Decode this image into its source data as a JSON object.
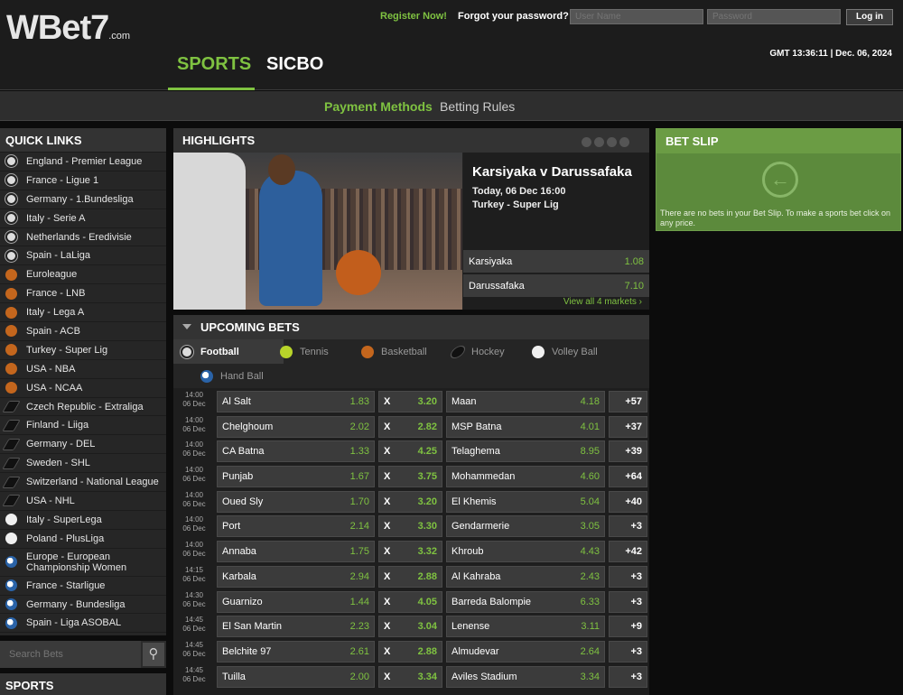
{
  "header": {
    "logo": "WBet7",
    "logo_suffix": ".com",
    "register": "Register Now!",
    "forgot": "Forgot your password?",
    "username_placeholder": "User Name",
    "password_placeholder": "Password",
    "login": "Log in",
    "clock": "GMT 13:36:11 | Dec. 06, 2024",
    "nav": {
      "sports": "SPORTS",
      "sicbo": "SICBO"
    }
  },
  "subnav": {
    "payment": "Payment Methods",
    "rules": "Betting Rules"
  },
  "quick_links": {
    "title": "QUICK LINKS",
    "items": [
      {
        "label": "England - Premier League",
        "icon": "football-icon"
      },
      {
        "label": "France - Ligue 1",
        "icon": "football-icon"
      },
      {
        "label": "Germany - 1.Bundesliga",
        "icon": "football-icon"
      },
      {
        "label": "Italy - Serie A",
        "icon": "football-icon"
      },
      {
        "label": "Netherlands - Eredivisie",
        "icon": "football-icon"
      },
      {
        "label": "Spain - LaLiga",
        "icon": "football-icon"
      },
      {
        "label": "Euroleague",
        "icon": "basketball-icon"
      },
      {
        "label": "France - LNB",
        "icon": "basketball-icon"
      },
      {
        "label": "Italy - Lega A",
        "icon": "basketball-icon"
      },
      {
        "label": "Spain - ACB",
        "icon": "basketball-icon"
      },
      {
        "label": "Turkey - Super Lig",
        "icon": "basketball-icon"
      },
      {
        "label": "USA - NBA",
        "icon": "basketball-icon"
      },
      {
        "label": "USA - NCAA",
        "icon": "basketball-icon"
      },
      {
        "label": "Czech Republic - Extraliga",
        "icon": "hockey-icon"
      },
      {
        "label": "Finland - Liiga",
        "icon": "hockey-icon"
      },
      {
        "label": "Germany - DEL",
        "icon": "hockey-icon"
      },
      {
        "label": "Sweden - SHL",
        "icon": "hockey-icon"
      },
      {
        "label": "Switzerland - National League",
        "icon": "hockey-icon"
      },
      {
        "label": "USA - NHL",
        "icon": "hockey-icon"
      },
      {
        "label": "Italy - SuperLega",
        "icon": "volleyball-icon"
      },
      {
        "label": "Poland - PlusLiga",
        "icon": "volleyball-icon"
      },
      {
        "label": "Europe - European Championship Women",
        "icon": "handball-icon"
      },
      {
        "label": "France - Starligue",
        "icon": "handball-icon"
      },
      {
        "label": "Germany - Bundesliga",
        "icon": "handball-icon"
      },
      {
        "label": "Spain - Liga ASOBAL",
        "icon": "handball-icon"
      }
    ],
    "search_placeholder": "Search Bets",
    "sports_title": "SPORTS"
  },
  "highlights": {
    "title": "HIGHLIGHTS",
    "match": "Karsiyaka v Darussafaka",
    "date": "Today, 06 Dec 16:00",
    "league": "Turkey - Super Lig",
    "teams": [
      {
        "name": "Karsiyaka",
        "odds": "1.08"
      },
      {
        "name": "Darussafaka",
        "odds": "7.10"
      }
    ],
    "view_all": "View all 4 markets"
  },
  "bet_slip": {
    "title": "BET SLIP",
    "empty_text": "There are no bets in your Bet Slip. To make a sports bet click on any price."
  },
  "upcoming": {
    "title": "UPCOMING BETS",
    "tabs": [
      {
        "label": "Football",
        "icon": "football-icon"
      },
      {
        "label": "Tennis",
        "icon": "tennis-icon"
      },
      {
        "label": "Basketball",
        "icon": "basketball-icon"
      },
      {
        "label": "Hockey",
        "icon": "hockey-icon"
      },
      {
        "label": "Volley Ball",
        "icon": "volleyball-icon"
      },
      {
        "label": "Hand Ball",
        "icon": "handball-icon"
      }
    ],
    "rows": [
      {
        "time": "14:00",
        "date": "06 Dec",
        "home": "Al Salt",
        "home_odds": "1.83",
        "draw": "X",
        "draw_odds": "3.20",
        "away": "Maan",
        "away_odds": "4.18",
        "more": "+57"
      },
      {
        "time": "14:00",
        "date": "06 Dec",
        "home": "Chelghoum",
        "home_odds": "2.02",
        "draw": "X",
        "draw_odds": "2.82",
        "away": "MSP Batna",
        "away_odds": "4.01",
        "more": "+37"
      },
      {
        "time": "14:00",
        "date": "06 Dec",
        "home": "CA Batna",
        "home_odds": "1.33",
        "draw": "X",
        "draw_odds": "4.25",
        "away": "Telaghema",
        "away_odds": "8.95",
        "more": "+39"
      },
      {
        "time": "14:00",
        "date": "06 Dec",
        "home": "Punjab",
        "home_odds": "1.67",
        "draw": "X",
        "draw_odds": "3.75",
        "away": "Mohammedan",
        "away_odds": "4.60",
        "more": "+64"
      },
      {
        "time": "14:00",
        "date": "06 Dec",
        "home": "Oued Sly",
        "home_odds": "1.70",
        "draw": "X",
        "draw_odds": "3.20",
        "away": "El Khemis",
        "away_odds": "5.04",
        "more": "+40"
      },
      {
        "time": "14:00",
        "date": "06 Dec",
        "home": "Port",
        "home_odds": "2.14",
        "draw": "X",
        "draw_odds": "3.30",
        "away": "Gendarmerie",
        "away_odds": "3.05",
        "more": "+3"
      },
      {
        "time": "14:00",
        "date": "06 Dec",
        "home": "Annaba",
        "home_odds": "1.75",
        "draw": "X",
        "draw_odds": "3.32",
        "away": "Khroub",
        "away_odds": "4.43",
        "more": "+42"
      },
      {
        "time": "14:15",
        "date": "06 Dec",
        "home": "Karbala",
        "home_odds": "2.94",
        "draw": "X",
        "draw_odds": "2.88",
        "away": "Al Kahraba",
        "away_odds": "2.43",
        "more": "+3"
      },
      {
        "time": "14:30",
        "date": "06 Dec",
        "home": "Guarnizo",
        "home_odds": "1.44",
        "draw": "X",
        "draw_odds": "4.05",
        "away": "Barreda Balompie",
        "away_odds": "6.33",
        "more": "+3"
      },
      {
        "time": "14:45",
        "date": "06 Dec",
        "home": "El San Martin",
        "home_odds": "2.23",
        "draw": "X",
        "draw_odds": "3.04",
        "away": "Lenense",
        "away_odds": "3.11",
        "more": "+9"
      },
      {
        "time": "14:45",
        "date": "06 Dec",
        "home": "Belchite 97",
        "home_odds": "2.61",
        "draw": "X",
        "draw_odds": "2.88",
        "away": "Almudevar",
        "away_odds": "2.64",
        "more": "+3"
      },
      {
        "time": "14:45",
        "date": "06 Dec",
        "home": "Tuilla",
        "home_odds": "2.00",
        "draw": "X",
        "draw_odds": "3.34",
        "away": "Aviles Stadium",
        "away_odds": "3.34",
        "more": "+3"
      }
    ]
  },
  "colors": {
    "accent": "#7fc241",
    "background": "#0c0c0c",
    "betslip": "#5c8a3c"
  }
}
